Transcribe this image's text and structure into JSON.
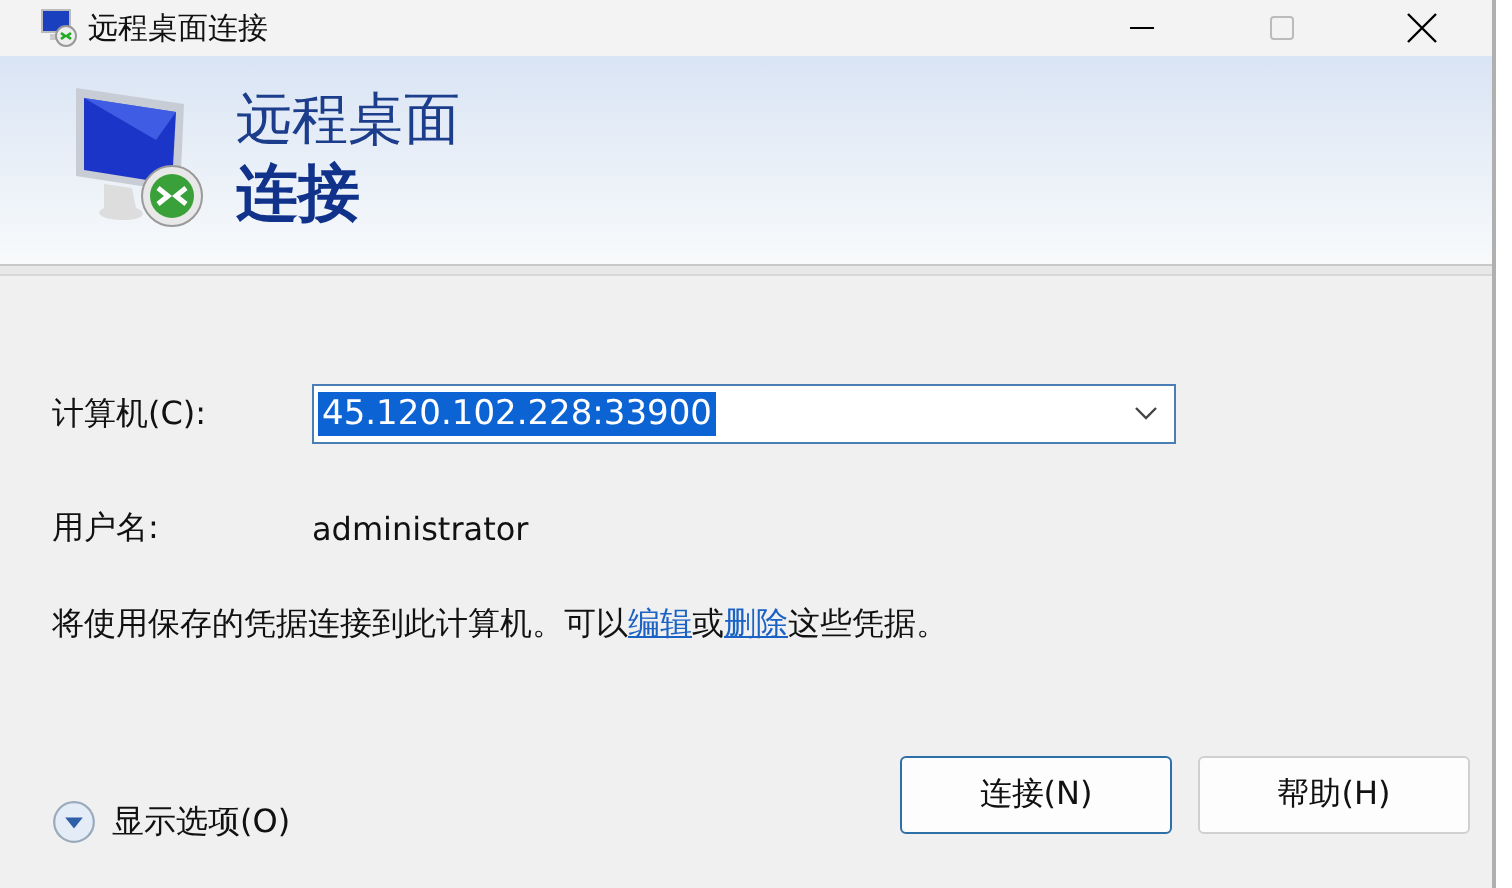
{
  "window": {
    "title": "远程桌面连接"
  },
  "banner": {
    "line_1": "远程桌面",
    "line_2": "连接"
  },
  "computer": {
    "label": "计算机(C):",
    "value": "45.120.102.228:33900",
    "text_selected": true
  },
  "username": {
    "label": "用户名:",
    "value": "administrator"
  },
  "credentials_note": [
    {
      "kind": "text",
      "text": "将使用保存的凭据连接到此计算机。可以"
    },
    {
      "kind": "link",
      "text": "编辑"
    },
    {
      "kind": "text",
      "text": "或"
    },
    {
      "kind": "link",
      "text": "删除"
    },
    {
      "kind": "text",
      "text": "这些凭据。"
    }
  ],
  "options_toggle": {
    "label": "显示选项(O)",
    "expanded": false
  },
  "buttons": [
    {
      "label": "连接(N)",
      "default": true
    },
    {
      "label": "帮助(H)",
      "default": false
    }
  ]
}
